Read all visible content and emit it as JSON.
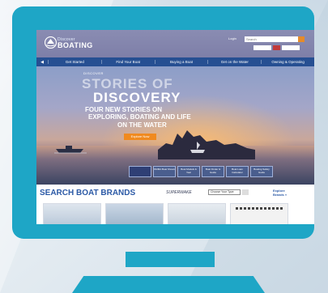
{
  "colors": {
    "monitor": "#1ea6c6",
    "nav_bar": "#264f92",
    "accent_orange": "#f08a1f",
    "brand_blue": "#2c5aa6",
    "background": "#e3ebf1"
  },
  "site": {
    "logo_top": "Discover",
    "logo_main": "BOATING",
    "login": "Login",
    "search_placeholder": "Search"
  },
  "nav": {
    "items": [
      {
        "label": "Get Started"
      },
      {
        "label": "Find Your Boat"
      },
      {
        "label": "Buying a Boat"
      },
      {
        "label": "Get on the Water"
      },
      {
        "label": "Owning & Operating"
      }
    ]
  },
  "hero": {
    "eyebrow": "DISCOVER",
    "title_line1": "STORIES OF",
    "title_line2": "DISCOVERY",
    "sub_line1": "FOUR NEW STORIES ON",
    "sub_line2": "EXPLORING, BOATING AND LIFE",
    "sub_line3": "ON THE WATER",
    "cta": "Explore Now"
  },
  "tiles": [
    {
      "label": "",
      "icon": "brand-logo-icon"
    },
    {
      "label": "NMMA Boat Shows",
      "icon": "tile-icon"
    },
    {
      "label": "Boat Models & Year",
      "icon": "tile-icon"
    },
    {
      "label": "Boat Finder & Guide",
      "icon": "tile-icon"
    },
    {
      "label": "Boat Loan Calculator",
      "icon": "tile-icon"
    },
    {
      "label": "Boating Safety Guide",
      "icon": "tile-icon"
    }
  ],
  "brands": {
    "title": "SEARCH BOAT BRANDS",
    "sponsor": "SUPERWAKE",
    "select_value": "Choose Your Type",
    "link_line1": "Explore",
    "link_line2": "Brands »"
  }
}
